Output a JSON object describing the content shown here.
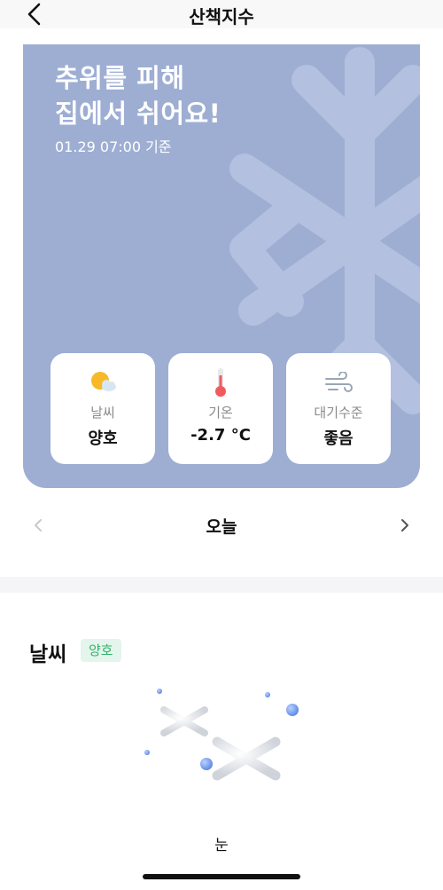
{
  "nav": {
    "title": "산책지수"
  },
  "hero": {
    "headline": "추위를 피해\n집에서 쉬어요!",
    "timestamp": "01.29 07:00 기준",
    "bg_color": "#9eaed3"
  },
  "cards": [
    {
      "label": "날씨",
      "value": "양호",
      "icon": "sun-cloud-icon"
    },
    {
      "label": "기온",
      "value": "-2.7 °C",
      "icon": "thermometer-icon"
    },
    {
      "label": "대기수준",
      "value": "좋음",
      "icon": "wind-icon"
    }
  ],
  "day_nav": {
    "label": "오늘"
  },
  "weather_section": {
    "title": "날씨",
    "badge": "양호",
    "badge_color": "#35b26b",
    "caption": "눈",
    "icon": "snowflakes-icon"
  }
}
